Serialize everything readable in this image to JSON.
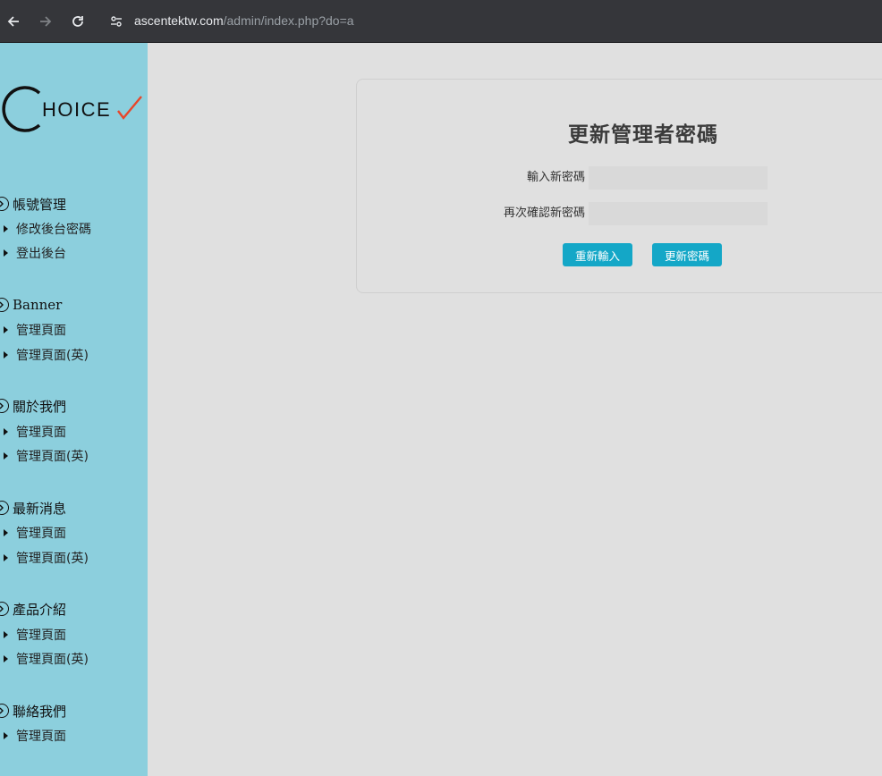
{
  "browser": {
    "url_host": "ascentektw.com",
    "url_path": "/admin/index.php?do=a",
    "icons": [
      "back-arrow-icon",
      "forward-arrow-icon",
      "reload-icon",
      "site-info-icon"
    ]
  },
  "sidebar": {
    "logo_text": "CHOICE",
    "sections": [
      {
        "title": "帳號管理",
        "items": [
          "修改後台密碼",
          "登出後台"
        ]
      },
      {
        "title": "Banner",
        "items": [
          "管理頁面",
          "管理頁面(英)"
        ]
      },
      {
        "title": "關於我們",
        "items": [
          "管理頁面",
          "管理頁面(英)"
        ]
      },
      {
        "title": "最新消息",
        "items": [
          "管理頁面",
          "管理頁面(英)"
        ]
      },
      {
        "title": "產品介紹",
        "items": [
          "管理頁面",
          "管理頁面(英)"
        ]
      },
      {
        "title": "聯絡我們",
        "items": [
          "管理頁面"
        ]
      }
    ]
  },
  "form": {
    "title": "更新管理者密碼",
    "new_password_label": "輸入新密碼",
    "confirm_password_label": "再次確認新密碼",
    "new_password_value": "",
    "confirm_password_value": "",
    "reset_button": "重新輸入",
    "submit_button": "更新密碼"
  },
  "colors": {
    "sidebar_bg": "#8ccfdd",
    "button_bg": "#14a7c7",
    "logo_check": "#e8462a"
  }
}
